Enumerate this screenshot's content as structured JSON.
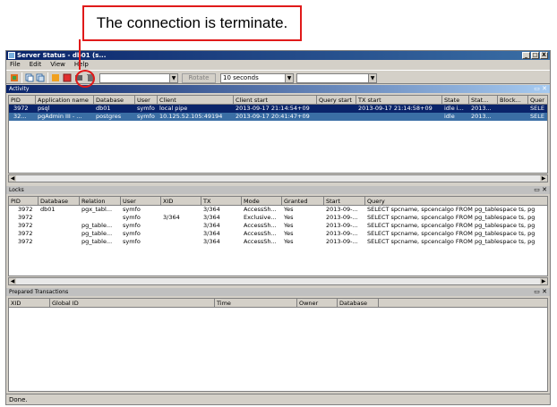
{
  "callout": {
    "text": "The connection is terminate."
  },
  "window": {
    "title": "Server Status - db01 (s...",
    "controls": [
      "_",
      "□",
      "X"
    ]
  },
  "menu": [
    "File",
    "Edit",
    "View",
    "Help"
  ],
  "toolbar": {
    "rotate_label": "Rotate",
    "refresh_interval": "10 seconds"
  },
  "activity": {
    "title": "Activity",
    "columns": [
      "PID",
      "Application name",
      "Database",
      "User",
      "Client",
      "Client start",
      "Query start",
      "TX start",
      "State",
      "Stat...",
      "Block...",
      "Quer"
    ],
    "rows": [
      [
        "3972",
        "psql",
        "db01",
        "symfo",
        "local pipe",
        "2013-09-17 21:14:54+09",
        "",
        "2013-09-17 21:14:58+09",
        "idle i...",
        "2013...",
        "",
        "SELE"
      ],
      [
        "32...",
        "pgAdmin III - ...",
        "postgres",
        "symfo",
        "10.125.52.105:49194",
        "2013-09-17 20:41:47+09",
        "",
        "",
        "idle",
        "2013...",
        "",
        "SELE"
      ]
    ]
  },
  "locks": {
    "title": "Locks",
    "columns": [
      "PID",
      "Database",
      "Relation",
      "User",
      "XID",
      "TX",
      "Mode",
      "Granted",
      "Start",
      "Query"
    ],
    "rows": [
      [
        "3972",
        "db01",
        "pgx_tabl...",
        "symfo",
        "",
        "3/364",
        "AccessSh...",
        "Yes",
        "2013-09-...",
        "SELECT spcname, spcencalgo FROM pg_tablespace ts, pg"
      ],
      [
        "3972",
        "",
        "",
        "symfo",
        "3/364",
        "3/364",
        "Exclusive...",
        "Yes",
        "2013-09-...",
        "SELECT spcname, spcencalgo FROM pg_tablespace ts, pg"
      ],
      [
        "3972",
        "",
        "pg_table...",
        "symfo",
        "",
        "3/364",
        "AccessSh...",
        "Yes",
        "2013-09-...",
        "SELECT spcname, spcencalgo FROM pg_tablespace ts, pg"
      ],
      [
        "3972",
        "",
        "pg_table...",
        "symfo",
        "",
        "3/364",
        "AccessSh...",
        "Yes",
        "2013-09-...",
        "SELECT spcname, spcencalgo FROM pg_tablespace ts, pg"
      ],
      [
        "3972",
        "",
        "pg_table...",
        "symfo",
        "",
        "3/364",
        "AccessSh...",
        "Yes",
        "2013-09-...",
        "SELECT spcname, spcencalgo FROM pg_tablespace ts, pg"
      ]
    ]
  },
  "prepared": {
    "title": "Prepared Transactions",
    "columns": [
      "XID",
      "Global ID",
      "Time",
      "Owner",
      "Database"
    ]
  },
  "status": {
    "text": "Done."
  },
  "colors": {
    "accent": "#e01a1a",
    "selection": "#0a246a",
    "title_bar": "#0a246a"
  }
}
